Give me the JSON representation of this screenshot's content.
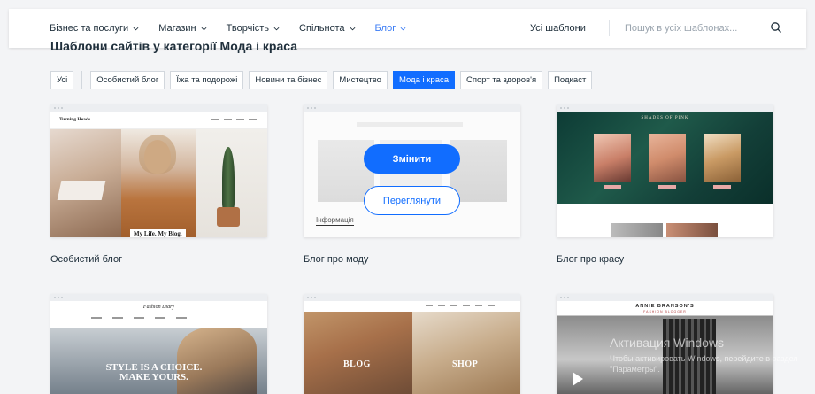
{
  "nav": {
    "items": [
      {
        "label": "Бізнес та послуги"
      },
      {
        "label": "Магазин"
      },
      {
        "label": "Творчість"
      },
      {
        "label": "Спільнота"
      },
      {
        "label": "Блог"
      }
    ],
    "all_templates": "Усі шаблони",
    "search_placeholder": "Пошук в усіх шаблонах...",
    "accent": "#3b7cf5"
  },
  "heading": "Шаблони сайтів у категорії Мода і краса",
  "filters": {
    "all": "Усі",
    "items": [
      "Особистий блог",
      "Їжа та подорожі",
      "Новини та бізнес",
      "Мистецтво",
      "Мода і краса",
      "Спорт та здоров'я",
      "Подкаст"
    ],
    "active": "Мода і краса",
    "active_color": "#116dff"
  },
  "cards": [
    {
      "title": "Особистий блог",
      "preview_logo": "Turning Heads",
      "preview_caption": "My Life. My Blog."
    },
    {
      "title": "Блог про моду",
      "primary_button": "Змінити",
      "secondary_button": "Переглянути",
      "info_link": "Інформація"
    },
    {
      "title": "Блог про красу",
      "preview_title": "SHADES OF PINK"
    },
    {
      "preview_logo": "Fashion Diary",
      "preview_text": "STYLE IS A CHOICE. MAKE YOURS."
    },
    {
      "preview_left": "BLOG",
      "preview_right": "SHOP"
    },
    {
      "preview_name": "ANNIE BRANSON'S",
      "preview_sub": "FASHION BLOGGER"
    }
  ],
  "watermark": {
    "line1": "Активация Windows",
    "line2": "Чтобы активировать Windows, перейдите в раздел \"Параметры\"."
  }
}
